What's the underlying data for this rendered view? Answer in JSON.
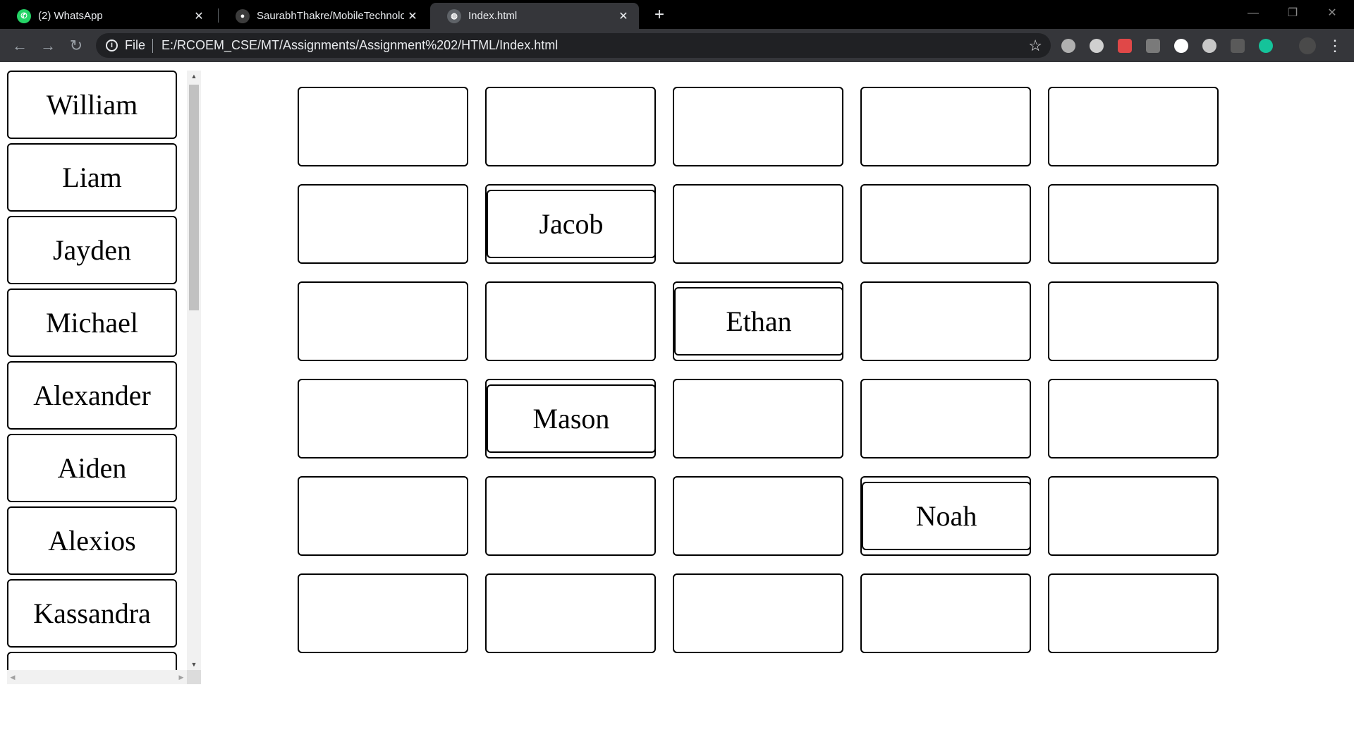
{
  "browser": {
    "tabs": [
      {
        "title": "(2) WhatsApp",
        "icon": "whatsapp-icon",
        "active": false
      },
      {
        "title": "SaurabhThakre/MobileTechnolog",
        "icon": "github-icon",
        "active": false
      },
      {
        "title": "Index.html",
        "icon": "globe-icon",
        "active": true
      }
    ],
    "address": {
      "scheme_label": "File",
      "url": "E:/RCOEM_CSE/MT/Assignments/Assignment%202/HTML/Index.html"
    },
    "window_controls": {
      "minimize": "—",
      "restore": "❐",
      "close": "✕"
    }
  },
  "names_list": [
    "William",
    "Liam",
    "Jayden",
    "Michael",
    "Alexander",
    "Aiden",
    "Alexios",
    "Kassandra",
    ""
  ],
  "grid": {
    "rows": 6,
    "cols": 5,
    "placed": [
      {
        "row": 1,
        "col": 1,
        "name": "Jacob"
      },
      {
        "row": 2,
        "col": 2,
        "name": "Ethan"
      },
      {
        "row": 3,
        "col": 1,
        "name": "Mason"
      },
      {
        "row": 4,
        "col": 3,
        "name": "Noah"
      }
    ]
  },
  "colors": {
    "tabbar": "#000000",
    "toolbar": "#35363a",
    "omnibox": "#202124",
    "border": "#000000"
  }
}
